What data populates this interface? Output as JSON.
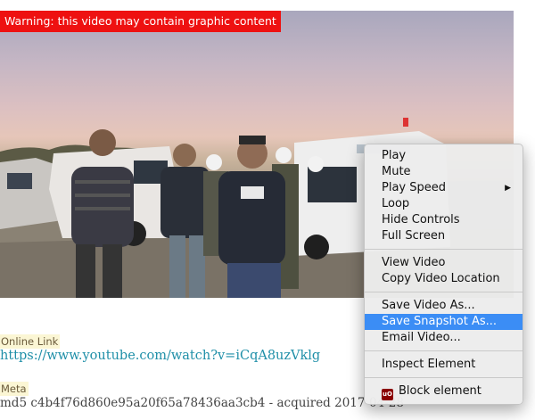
{
  "video": {
    "warning": "Warning: this video may contain graphic content"
  },
  "online_link": {
    "label": "Online Link",
    "url": "https://www.youtube.com/watch?v=iCqA8uzVklg"
  },
  "meta": {
    "label": "Meta",
    "value": "md5 c4b4f76d860e95a20f65a78436aa3cb4 - acquired 2017-04-28"
  },
  "context_menu": {
    "groups": [
      [
        {
          "label": "Play"
        },
        {
          "label": "Mute"
        },
        {
          "label": "Play Speed",
          "submenu": true
        },
        {
          "label": "Loop"
        },
        {
          "label": "Hide Controls"
        },
        {
          "label": "Full Screen"
        }
      ],
      [
        {
          "label": "View Video"
        },
        {
          "label": "Copy Video Location"
        }
      ],
      [
        {
          "label": "Save Video As..."
        },
        {
          "label": "Save Snapshot As...",
          "highlighted": true
        },
        {
          "label": "Email Video..."
        }
      ],
      [
        {
          "label": "Inspect Element"
        }
      ],
      [
        {
          "label": "Block element",
          "icon": "ublock-icon"
        }
      ]
    ],
    "highlight_color": "#3b8df5",
    "submenu_arrow": "▶",
    "ublock_icon_text": "uO"
  },
  "colors": {
    "warning_bg": "#ee1111",
    "link": "#1f8fa8",
    "label_bg": "#fbf6d4"
  }
}
